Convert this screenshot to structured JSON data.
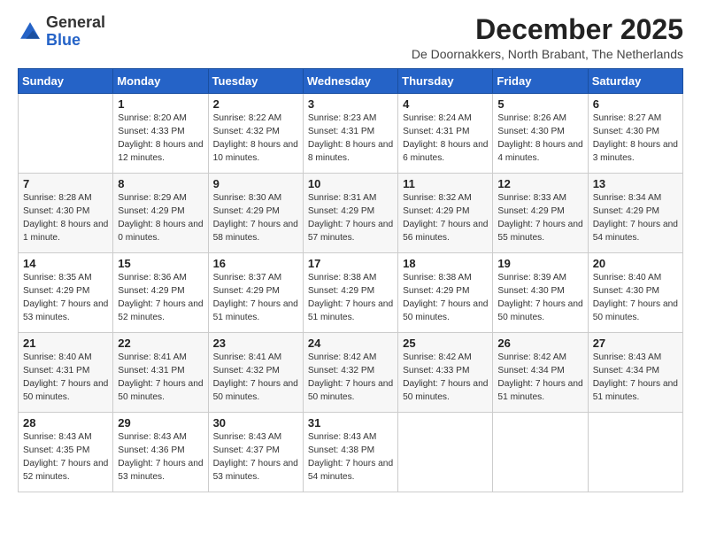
{
  "header": {
    "logo": {
      "general": "General",
      "blue": "Blue"
    },
    "title": "December 2025",
    "subtitle": "De Doornakkers, North Brabant, The Netherlands"
  },
  "calendar": {
    "days_of_week": [
      "Sunday",
      "Monday",
      "Tuesday",
      "Wednesday",
      "Thursday",
      "Friday",
      "Saturday"
    ],
    "weeks": [
      [
        {
          "day": null
        },
        {
          "day": "1",
          "sunrise": "Sunrise: 8:20 AM",
          "sunset": "Sunset: 4:33 PM",
          "daylight": "Daylight: 8 hours and 12 minutes."
        },
        {
          "day": "2",
          "sunrise": "Sunrise: 8:22 AM",
          "sunset": "Sunset: 4:32 PM",
          "daylight": "Daylight: 8 hours and 10 minutes."
        },
        {
          "day": "3",
          "sunrise": "Sunrise: 8:23 AM",
          "sunset": "Sunset: 4:31 PM",
          "daylight": "Daylight: 8 hours and 8 minutes."
        },
        {
          "day": "4",
          "sunrise": "Sunrise: 8:24 AM",
          "sunset": "Sunset: 4:31 PM",
          "daylight": "Daylight: 8 hours and 6 minutes."
        },
        {
          "day": "5",
          "sunrise": "Sunrise: 8:26 AM",
          "sunset": "Sunset: 4:30 PM",
          "daylight": "Daylight: 8 hours and 4 minutes."
        },
        {
          "day": "6",
          "sunrise": "Sunrise: 8:27 AM",
          "sunset": "Sunset: 4:30 PM",
          "daylight": "Daylight: 8 hours and 3 minutes."
        }
      ],
      [
        {
          "day": "7",
          "sunrise": "Sunrise: 8:28 AM",
          "sunset": "Sunset: 4:30 PM",
          "daylight": "Daylight: 8 hours and 1 minute."
        },
        {
          "day": "8",
          "sunrise": "Sunrise: 8:29 AM",
          "sunset": "Sunset: 4:29 PM",
          "daylight": "Daylight: 8 hours and 0 minutes."
        },
        {
          "day": "9",
          "sunrise": "Sunrise: 8:30 AM",
          "sunset": "Sunset: 4:29 PM",
          "daylight": "Daylight: 7 hours and 58 minutes."
        },
        {
          "day": "10",
          "sunrise": "Sunrise: 8:31 AM",
          "sunset": "Sunset: 4:29 PM",
          "daylight": "Daylight: 7 hours and 57 minutes."
        },
        {
          "day": "11",
          "sunrise": "Sunrise: 8:32 AM",
          "sunset": "Sunset: 4:29 PM",
          "daylight": "Daylight: 7 hours and 56 minutes."
        },
        {
          "day": "12",
          "sunrise": "Sunrise: 8:33 AM",
          "sunset": "Sunset: 4:29 PM",
          "daylight": "Daylight: 7 hours and 55 minutes."
        },
        {
          "day": "13",
          "sunrise": "Sunrise: 8:34 AM",
          "sunset": "Sunset: 4:29 PM",
          "daylight": "Daylight: 7 hours and 54 minutes."
        }
      ],
      [
        {
          "day": "14",
          "sunrise": "Sunrise: 8:35 AM",
          "sunset": "Sunset: 4:29 PM",
          "daylight": "Daylight: 7 hours and 53 minutes."
        },
        {
          "day": "15",
          "sunrise": "Sunrise: 8:36 AM",
          "sunset": "Sunset: 4:29 PM",
          "daylight": "Daylight: 7 hours and 52 minutes."
        },
        {
          "day": "16",
          "sunrise": "Sunrise: 8:37 AM",
          "sunset": "Sunset: 4:29 PM",
          "daylight": "Daylight: 7 hours and 51 minutes."
        },
        {
          "day": "17",
          "sunrise": "Sunrise: 8:38 AM",
          "sunset": "Sunset: 4:29 PM",
          "daylight": "Daylight: 7 hours and 51 minutes."
        },
        {
          "day": "18",
          "sunrise": "Sunrise: 8:38 AM",
          "sunset": "Sunset: 4:29 PM",
          "daylight": "Daylight: 7 hours and 50 minutes."
        },
        {
          "day": "19",
          "sunrise": "Sunrise: 8:39 AM",
          "sunset": "Sunset: 4:30 PM",
          "daylight": "Daylight: 7 hours and 50 minutes."
        },
        {
          "day": "20",
          "sunrise": "Sunrise: 8:40 AM",
          "sunset": "Sunset: 4:30 PM",
          "daylight": "Daylight: 7 hours and 50 minutes."
        }
      ],
      [
        {
          "day": "21",
          "sunrise": "Sunrise: 8:40 AM",
          "sunset": "Sunset: 4:31 PM",
          "daylight": "Daylight: 7 hours and 50 minutes."
        },
        {
          "day": "22",
          "sunrise": "Sunrise: 8:41 AM",
          "sunset": "Sunset: 4:31 PM",
          "daylight": "Daylight: 7 hours and 50 minutes."
        },
        {
          "day": "23",
          "sunrise": "Sunrise: 8:41 AM",
          "sunset": "Sunset: 4:32 PM",
          "daylight": "Daylight: 7 hours and 50 minutes."
        },
        {
          "day": "24",
          "sunrise": "Sunrise: 8:42 AM",
          "sunset": "Sunset: 4:32 PM",
          "daylight": "Daylight: 7 hours and 50 minutes."
        },
        {
          "day": "25",
          "sunrise": "Sunrise: 8:42 AM",
          "sunset": "Sunset: 4:33 PM",
          "daylight": "Daylight: 7 hours and 50 minutes."
        },
        {
          "day": "26",
          "sunrise": "Sunrise: 8:42 AM",
          "sunset": "Sunset: 4:34 PM",
          "daylight": "Daylight: 7 hours and 51 minutes."
        },
        {
          "day": "27",
          "sunrise": "Sunrise: 8:43 AM",
          "sunset": "Sunset: 4:34 PM",
          "daylight": "Daylight: 7 hours and 51 minutes."
        }
      ],
      [
        {
          "day": "28",
          "sunrise": "Sunrise: 8:43 AM",
          "sunset": "Sunset: 4:35 PM",
          "daylight": "Daylight: 7 hours and 52 minutes."
        },
        {
          "day": "29",
          "sunrise": "Sunrise: 8:43 AM",
          "sunset": "Sunset: 4:36 PM",
          "daylight": "Daylight: 7 hours and 53 minutes."
        },
        {
          "day": "30",
          "sunrise": "Sunrise: 8:43 AM",
          "sunset": "Sunset: 4:37 PM",
          "daylight": "Daylight: 7 hours and 53 minutes."
        },
        {
          "day": "31",
          "sunrise": "Sunrise: 8:43 AM",
          "sunset": "Sunset: 4:38 PM",
          "daylight": "Daylight: 7 hours and 54 minutes."
        },
        {
          "day": null
        },
        {
          "day": null
        },
        {
          "day": null
        }
      ]
    ]
  }
}
